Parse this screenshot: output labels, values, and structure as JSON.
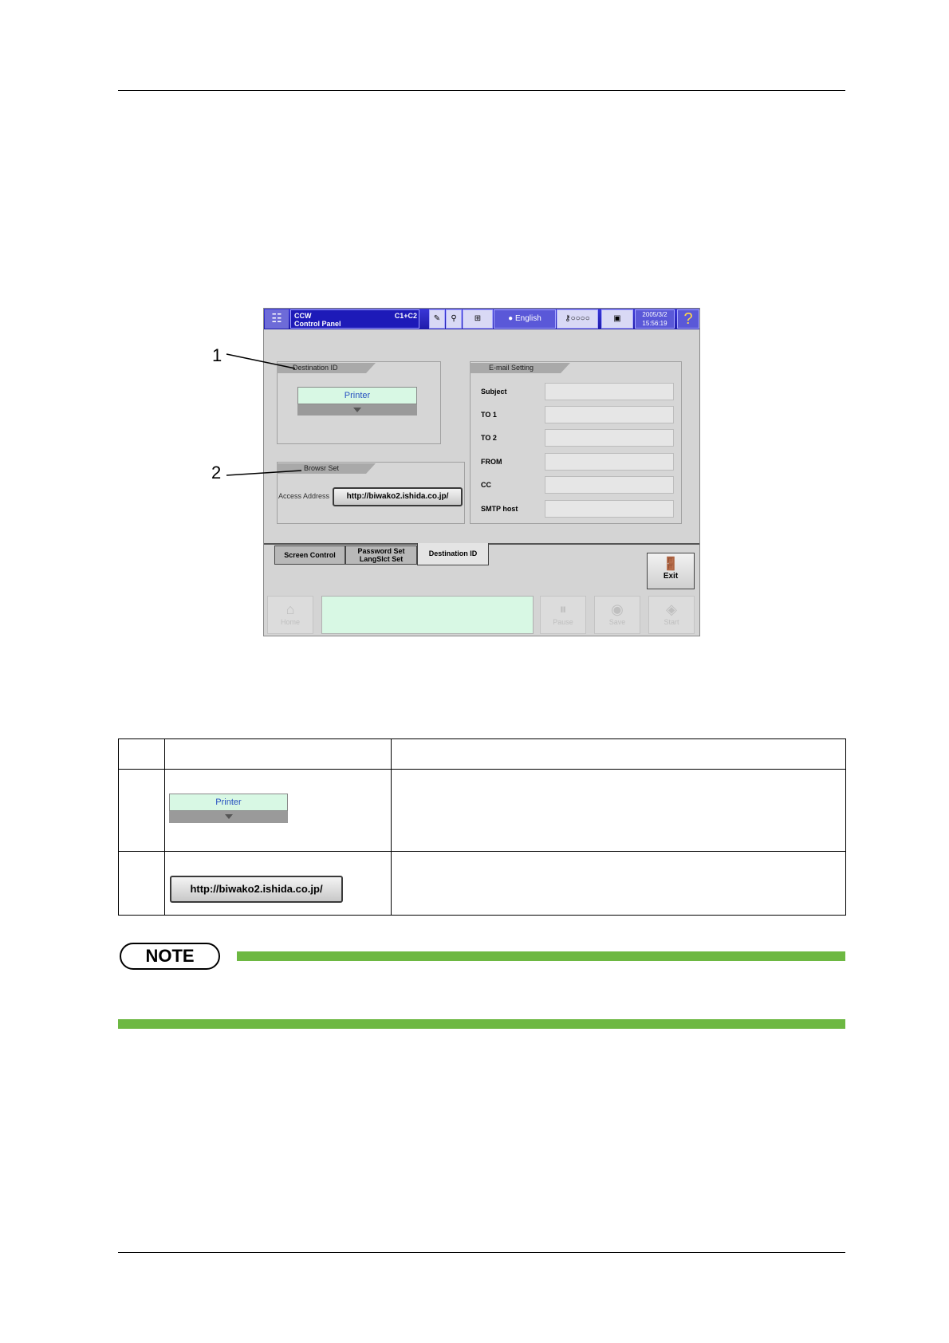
{
  "window": {
    "app_title_line1": "CCW",
    "app_title_line2": "Control Panel",
    "mode_code": "C1+C2",
    "language": "English",
    "date": "2005/3/2",
    "time": "15:56:19",
    "help": "?"
  },
  "callouts": {
    "one": "1",
    "two": "2"
  },
  "dest_panel": {
    "tab_label": "Destination ID",
    "selected_value": "Printer"
  },
  "browser_panel": {
    "tab_label": "Browsr Set",
    "access_label": "Access Address",
    "url": "http://biwako2.ishida.co.jp/"
  },
  "email_panel": {
    "tab_label": "E-mail Setting",
    "fields": [
      {
        "label": "Subject",
        "value": ""
      },
      {
        "label": "TO 1",
        "value": ""
      },
      {
        "label": "TO 2",
        "value": ""
      },
      {
        "label": "FROM",
        "value": ""
      },
      {
        "label": "CC",
        "value": ""
      },
      {
        "label": "SMTP host",
        "value": ""
      }
    ]
  },
  "tabs": [
    {
      "label": "Screen Control"
    },
    {
      "label_line1": "Password Set",
      "label_line2": "LangSlct Set"
    },
    {
      "label": "Destination ID"
    }
  ],
  "exit_label": "Exit",
  "bottom_buttons": [
    {
      "label": "Home"
    },
    {
      "label": "Pause"
    },
    {
      "label": "Save"
    },
    {
      "label": "Start"
    }
  ],
  "table": {
    "row1_value": "Printer",
    "row2_value": "http://biwako2.ishida.co.jp/"
  },
  "note": {
    "label": "NOTE"
  }
}
